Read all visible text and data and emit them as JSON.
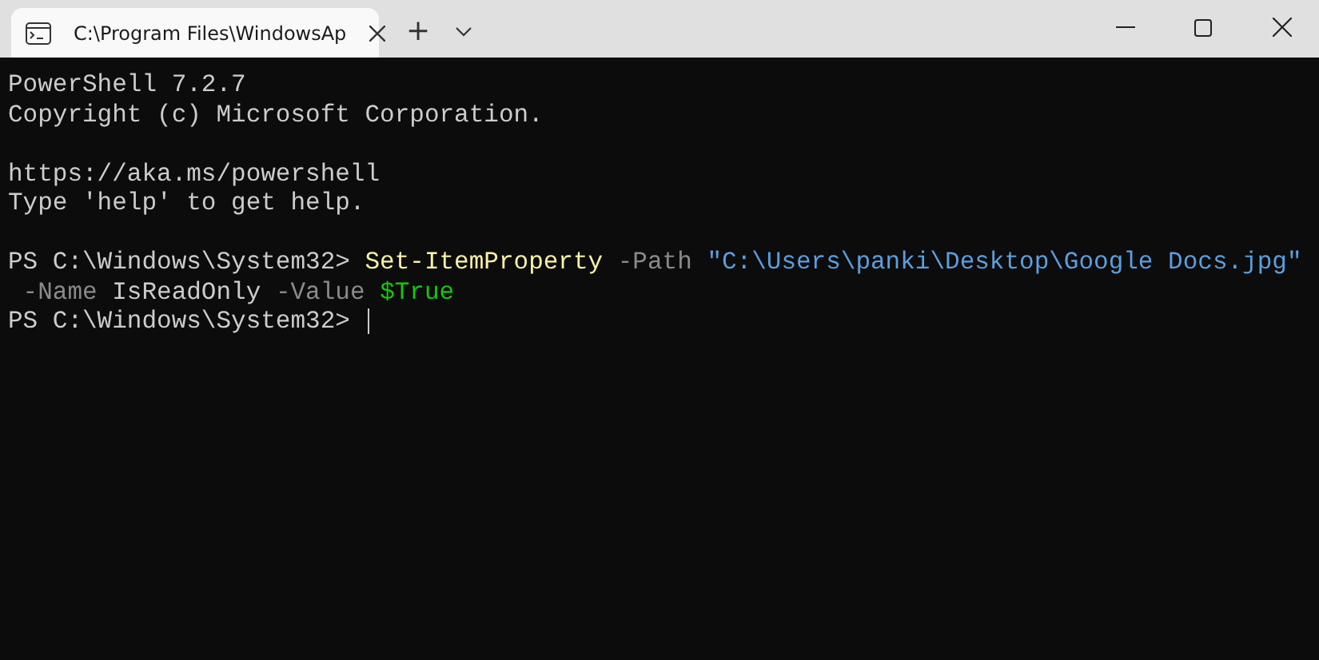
{
  "tabs": [
    {
      "title": "C:\\Program Files\\WindowsAp",
      "selected": true
    }
  ],
  "new_tab_button": "+",
  "terminal": {
    "blocks": [
      [
        [
          {
            "text": "PowerShell 7.2.7",
            "kind": "output"
          }
        ],
        [
          {
            "text": "Copyright (c) Microsoft Corporation.",
            "kind": "output"
          }
        ]
      ],
      [
        [
          {
            "text": "https://aka.ms/powershell",
            "kind": "output"
          }
        ],
        [
          {
            "text": "Type 'help' to get help.",
            "kind": "output"
          }
        ]
      ],
      [
        [
          {
            "text": "PS C:\\Windows\\System32> ",
            "kind": "prompt"
          },
          {
            "text": "Set-ItemProperty",
            "kind": "command"
          },
          {
            "text": " -Path",
            "kind": "parameter"
          },
          {
            "text": " \"C:\\Users\\panki\\Desktop\\Google Docs.jpg\"",
            "kind": "string"
          }
        ],
        [
          {
            "text": " -Name",
            "kind": "parameter"
          },
          {
            "text": " IsReadOnly",
            "kind": "output"
          },
          {
            "text": " -Value",
            "kind": "parameter"
          },
          {
            "text": " $True",
            "kind": "variable"
          }
        ],
        [
          {
            "text": "PS C:\\Windows\\System32> ",
            "kind": "prompt"
          },
          {
            "kind": "cursor"
          }
        ]
      ]
    ]
  }
}
